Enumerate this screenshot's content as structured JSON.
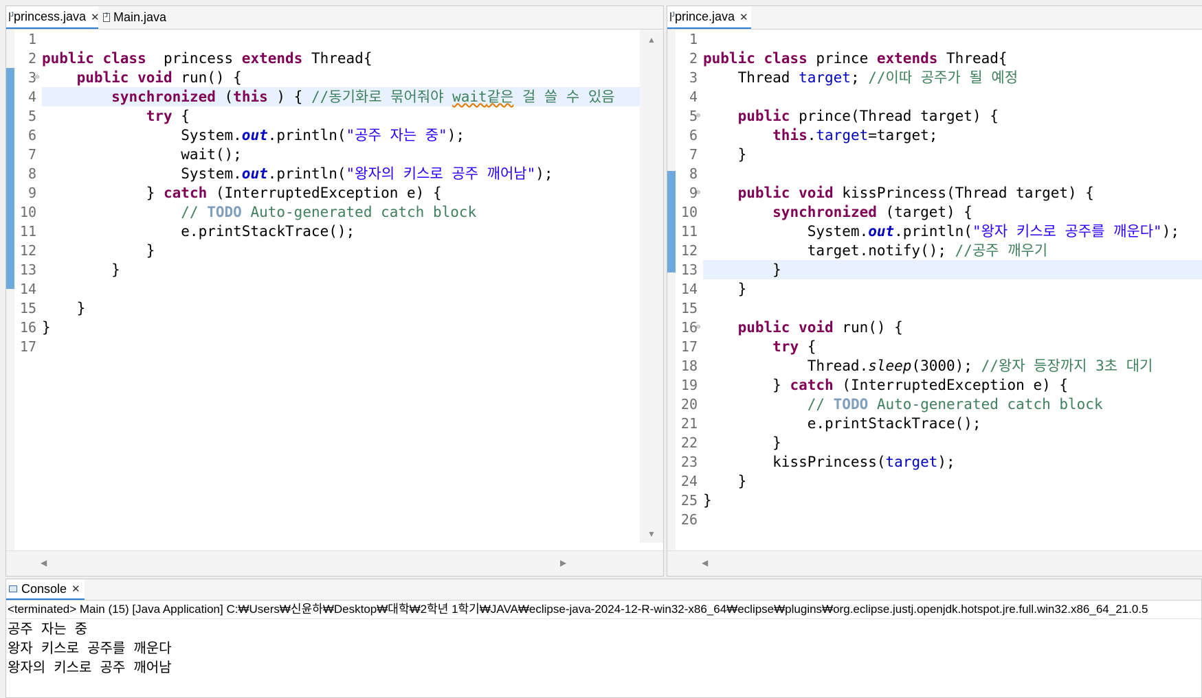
{
  "left_editor": {
    "tabs": [
      {
        "label": "princess.java",
        "close": "✕"
      },
      {
        "label": "Main.java"
      }
    ],
    "lines": [
      {
        "n": "1",
        "hl": false,
        "t": []
      },
      {
        "n": "2",
        "hl": false,
        "t": [
          [
            "kw",
            "public class"
          ],
          [
            "",
            "  princess "
          ],
          [
            "kw",
            "extends"
          ],
          [
            "",
            " Thread{"
          ]
        ]
      },
      {
        "n": "3",
        "hl": false,
        "fold": true,
        "ov": true,
        "t": [
          [
            "",
            "    "
          ],
          [
            "kw",
            "public void"
          ],
          [
            "",
            " run() {"
          ]
        ]
      },
      {
        "n": "4",
        "hl": true,
        "t": [
          [
            "",
            "        "
          ],
          [
            "kw",
            "synchronized"
          ],
          [
            "",
            " ("
          ],
          [
            "kw",
            "this"
          ],
          [
            "",
            " ) { "
          ],
          [
            "cmt",
            "//동기화로 묶어줘야 "
          ],
          [
            "cmt squig",
            "wait"
          ],
          [
            "cmt squig",
            "같은"
          ],
          [
            "cmt",
            " 걸 쓸 수 있음"
          ]
        ]
      },
      {
        "n": "5",
        "hl": false,
        "t": [
          [
            "",
            "            "
          ],
          [
            "kw",
            "try"
          ],
          [
            "",
            " {"
          ]
        ]
      },
      {
        "n": "6",
        "hl": false,
        "t": [
          [
            "",
            "                System."
          ],
          [
            "sfld",
            "out"
          ],
          [
            "",
            ".println("
          ],
          [
            "str",
            "\"공주 자는 중\""
          ],
          [
            "",
            ");"
          ]
        ]
      },
      {
        "n": "7",
        "hl": false,
        "t": [
          [
            "",
            "                wait();"
          ]
        ]
      },
      {
        "n": "8",
        "hl": false,
        "t": [
          [
            "",
            "                System."
          ],
          [
            "sfld",
            "out"
          ],
          [
            "",
            ".println("
          ],
          [
            "str",
            "\"왕자의 키스로 공주 깨어남\""
          ],
          [
            "",
            ");"
          ]
        ]
      },
      {
        "n": "9",
        "hl": false,
        "t": [
          [
            "",
            "            } "
          ],
          [
            "kw",
            "catch"
          ],
          [
            "",
            " (InterruptedException e) {"
          ]
        ]
      },
      {
        "n": "10",
        "hl": false,
        "t": [
          [
            "",
            "                "
          ],
          [
            "cmt",
            "// "
          ],
          [
            "todo",
            "TODO"
          ],
          [
            "cmt",
            " Auto-generated catch block"
          ]
        ]
      },
      {
        "n": "11",
        "hl": false,
        "t": [
          [
            "",
            "                e.printStackTrace();"
          ]
        ]
      },
      {
        "n": "12",
        "hl": false,
        "t": [
          [
            "",
            "            }"
          ]
        ]
      },
      {
        "n": "13",
        "hl": false,
        "t": [
          [
            "",
            "        }"
          ]
        ]
      },
      {
        "n": "14",
        "hl": false,
        "t": []
      },
      {
        "n": "15",
        "hl": false,
        "t": [
          [
            "",
            "    }"
          ]
        ]
      },
      {
        "n": "16",
        "hl": false,
        "t": [
          [
            "",
            "}"
          ]
        ]
      },
      {
        "n": "17",
        "hl": false,
        "t": []
      }
    ]
  },
  "right_editor": {
    "tabs": [
      {
        "label": "prince.java",
        "close": "✕"
      }
    ],
    "lines": [
      {
        "n": "1",
        "hl": false,
        "t": []
      },
      {
        "n": "2",
        "hl": false,
        "t": [
          [
            "kw",
            "public class"
          ],
          [
            "",
            " prince "
          ],
          [
            "kw",
            "extends"
          ],
          [
            "",
            " Thread{"
          ]
        ]
      },
      {
        "n": "3",
        "hl": false,
        "t": [
          [
            "",
            "    Thread "
          ],
          [
            "fld",
            "target"
          ],
          [
            "",
            "; "
          ],
          [
            "cmt",
            "//이따 공주가 될 예정"
          ]
        ]
      },
      {
        "n": "4",
        "hl": false,
        "t": []
      },
      {
        "n": "5",
        "hl": false,
        "fold": true,
        "t": [
          [
            "",
            "    "
          ],
          [
            "kw",
            "public"
          ],
          [
            "",
            " prince(Thread target) {"
          ]
        ]
      },
      {
        "n": "6",
        "hl": false,
        "t": [
          [
            "",
            "        "
          ],
          [
            "kw",
            "this"
          ],
          [
            "",
            "."
          ],
          [
            "fld",
            "target"
          ],
          [
            "",
            "=target;"
          ]
        ]
      },
      {
        "n": "7",
        "hl": false,
        "t": [
          [
            "",
            "    }"
          ]
        ]
      },
      {
        "n": "8",
        "hl": false,
        "t": []
      },
      {
        "n": "9",
        "hl": false,
        "fold": true,
        "t": [
          [
            "",
            "    "
          ],
          [
            "kw",
            "public void"
          ],
          [
            "",
            " kissPrincess(Thread target) {"
          ]
        ]
      },
      {
        "n": "10",
        "hl": false,
        "t": [
          [
            "",
            "        "
          ],
          [
            "kw",
            "synchronized"
          ],
          [
            "",
            " (target) {"
          ]
        ]
      },
      {
        "n": "11",
        "hl": false,
        "t": [
          [
            "",
            "            System."
          ],
          [
            "sfld",
            "out"
          ],
          [
            "",
            ".println("
          ],
          [
            "str",
            "\"왕자 키스로 공주를 깨운다\""
          ],
          [
            "",
            ");"
          ]
        ]
      },
      {
        "n": "12",
        "hl": false,
        "t": [
          [
            "",
            "            target.notify(); "
          ],
          [
            "cmt",
            "//공주 깨우기"
          ]
        ]
      },
      {
        "n": "13",
        "hl": true,
        "t": [
          [
            "",
            "        }"
          ]
        ]
      },
      {
        "n": "14",
        "hl": false,
        "t": [
          [
            "",
            "    }"
          ]
        ]
      },
      {
        "n": "15",
        "hl": false,
        "t": []
      },
      {
        "n": "16",
        "hl": false,
        "fold": true,
        "ov": true,
        "t": [
          [
            "",
            "    "
          ],
          [
            "kw",
            "public void"
          ],
          [
            "",
            " run() {"
          ]
        ]
      },
      {
        "n": "17",
        "hl": false,
        "t": [
          [
            "",
            "        "
          ],
          [
            "kw",
            "try"
          ],
          [
            "",
            " {"
          ]
        ]
      },
      {
        "n": "18",
        "hl": false,
        "t": [
          [
            "",
            "            Thread."
          ],
          [
            "it",
            "sleep"
          ],
          [
            "",
            "(3000); "
          ],
          [
            "cmt",
            "//왕자 등장까지 3초 대기"
          ]
        ]
      },
      {
        "n": "19",
        "hl": false,
        "t": [
          [
            "",
            "        } "
          ],
          [
            "kw",
            "catch"
          ],
          [
            "",
            " (InterruptedException e) {"
          ]
        ]
      },
      {
        "n": "20",
        "hl": false,
        "t": [
          [
            "",
            "            "
          ],
          [
            "cmt",
            "// "
          ],
          [
            "todo",
            "TODO"
          ],
          [
            "cmt",
            " Auto-generated catch block"
          ]
        ]
      },
      {
        "n": "21",
        "hl": false,
        "t": [
          [
            "",
            "            e.printStackTrace();"
          ]
        ]
      },
      {
        "n": "22",
        "hl": false,
        "t": [
          [
            "",
            "        }"
          ]
        ]
      },
      {
        "n": "23",
        "hl": false,
        "t": [
          [
            "",
            "        kissPrincess("
          ],
          [
            "fld",
            "target"
          ],
          [
            "",
            ");"
          ]
        ]
      },
      {
        "n": "24",
        "hl": false,
        "t": [
          [
            "",
            "    }"
          ]
        ]
      },
      {
        "n": "25",
        "hl": false,
        "t": [
          [
            "",
            "}"
          ]
        ]
      },
      {
        "n": "26",
        "hl": false,
        "t": []
      }
    ]
  },
  "console": {
    "tab_label": "Console",
    "tab_close": "✕",
    "status": "<terminated> Main (15) [Java Application] C:₩Users₩신윤하₩Desktop₩대학₩2학년 1학기₩JAVA₩eclipse-java-2024-12-R-win32-x86_64₩eclipse₩plugins₩org.eclipse.justj.openjdk.hotspot.jre.full.win32.x86_64_21.0.5",
    "output": [
      "공주 자는 중",
      "왕자 키스로 공주를 깨운다",
      "왕자의 키스로 공주 깨어남"
    ]
  },
  "icons": {
    "file": "java-file-icon",
    "console": "console-icon",
    "close": "close-icon"
  }
}
